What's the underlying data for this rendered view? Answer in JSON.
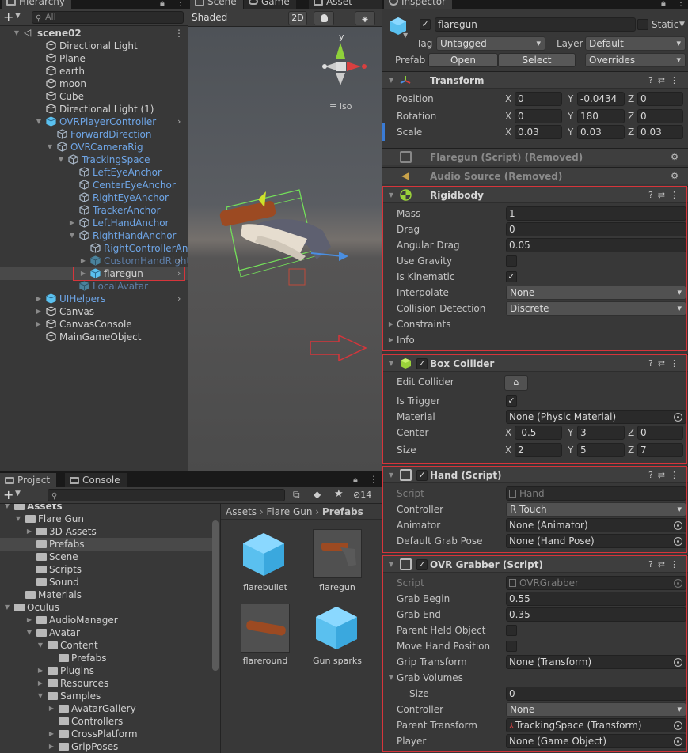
{
  "hierarchy": {
    "tab": "Hierarchy",
    "search_placeholder": "All",
    "items": [
      {
        "label": "scene02"
      },
      {
        "label": "Directional Light"
      },
      {
        "label": "Plane"
      },
      {
        "label": "earth"
      },
      {
        "label": "moon"
      },
      {
        "label": "Cube"
      },
      {
        "label": "Directional Light (1)"
      },
      {
        "label": "OVRPlayerController"
      },
      {
        "label": "ForwardDirection"
      },
      {
        "label": "OVRCameraRig"
      },
      {
        "label": "TrackingSpace"
      },
      {
        "label": "LeftEyeAnchor"
      },
      {
        "label": "CenterEyeAnchor"
      },
      {
        "label": "RightEyeAnchor"
      },
      {
        "label": "TrackerAnchor"
      },
      {
        "label": "LeftHandAnchor"
      },
      {
        "label": "RightHandAnchor"
      },
      {
        "label": "RightControllerAnchor"
      },
      {
        "label": "CustomHandRight"
      },
      {
        "label": "flaregun"
      },
      {
        "label": "LocalAvatar"
      },
      {
        "label": "UIHelpers"
      },
      {
        "label": "Canvas"
      },
      {
        "label": "CanvasConsole"
      },
      {
        "label": "MainGameObject"
      }
    ]
  },
  "scene": {
    "tabs": [
      "Scene",
      "Game",
      "Asset"
    ],
    "shading": "Shaded",
    "mode_2d": "2D",
    "gizmo_y": "y",
    "gizmo_projection": "Iso"
  },
  "inspector": {
    "tab": "Inspector",
    "object_name": "flaregun",
    "static_label": "Static",
    "tag_label": "Tag",
    "tag_value": "Untagged",
    "layer_label": "Layer",
    "layer_value": "Default",
    "prefab_label": "Prefab",
    "prefab_open": "Open",
    "prefab_select": "Select",
    "prefab_overrides": "Overrides",
    "transform": {
      "title": "Transform",
      "position_label": "Position",
      "position": [
        "0",
        "-0.0434",
        "0"
      ],
      "rotation_label": "Rotation",
      "rotation": [
        "0",
        "180",
        "0"
      ],
      "scale_label": "Scale",
      "scale": [
        "0.03",
        "0.03",
        "0.03"
      ],
      "axes": [
        "X",
        "Y",
        "Z"
      ]
    },
    "removed1": "Flaregun (Script) (Removed)",
    "removed2": "Audio Source (Removed)",
    "rigidbody": {
      "title": "Rigidbody",
      "mass_label": "Mass",
      "mass": "1",
      "drag_label": "Drag",
      "drag": "0",
      "angular_drag_label": "Angular Drag",
      "angular_drag": "0.05",
      "use_gravity_label": "Use Gravity",
      "is_kinematic_label": "Is Kinematic",
      "interpolate_label": "Interpolate",
      "interpolate": "None",
      "collision_label": "Collision Detection",
      "collision": "Discrete",
      "constraints_label": "Constraints",
      "info_label": "Info"
    },
    "box_collider": {
      "title": "Box Collider",
      "edit_label": "Edit Collider",
      "is_trigger_label": "Is Trigger",
      "material_label": "Material",
      "material": "None (Physic Material)",
      "center_label": "Center",
      "center": [
        "-0.5",
        "3",
        "0"
      ],
      "size_label": "Size",
      "size": [
        "2",
        "5",
        "7"
      ]
    },
    "hand_script": {
      "title": "Hand (Script)",
      "script_label": "Script",
      "script": "Hand",
      "controller_label": "Controller",
      "controller": "R Touch",
      "animator_label": "Animator",
      "animator": "None (Animator)",
      "grab_pose_label": "Default Grab Pose",
      "grab_pose": "None (Hand Pose)"
    },
    "ovr_grabber": {
      "title": "OVR Grabber (Script)",
      "script_label": "Script",
      "script": "OVRGrabber",
      "grab_begin_label": "Grab Begin",
      "grab_begin": "0.55",
      "grab_end_label": "Grab End",
      "grab_end": "0.35",
      "parent_held_label": "Parent Held Object",
      "move_hand_label": "Move Hand Position",
      "grip_label": "Grip Transform",
      "grip": "None (Transform)",
      "volumes_label": "Grab Volumes",
      "vol_size_label": "Size",
      "vol_size": "0",
      "controller_label": "Controller",
      "controller": "None",
      "parent_transform_label": "Parent Transform",
      "parent_transform": "TrackingSpace (Transform)",
      "player_label": "Player",
      "player": "None (Game Object)"
    }
  },
  "project": {
    "tabs": [
      "Project",
      "Console"
    ],
    "hidden_count": "14",
    "tree": [
      {
        "label": "Assets"
      },
      {
        "label": "Flare Gun"
      },
      {
        "label": "3D Assets"
      },
      {
        "label": "Prefabs"
      },
      {
        "label": "Scene"
      },
      {
        "label": "Scripts"
      },
      {
        "label": "Sound"
      },
      {
        "label": "Materials"
      },
      {
        "label": "Oculus"
      },
      {
        "label": "AudioManager"
      },
      {
        "label": "Avatar"
      },
      {
        "label": "Content"
      },
      {
        "label": "Prefabs"
      },
      {
        "label": "Plugins"
      },
      {
        "label": "Resources"
      },
      {
        "label": "Samples"
      },
      {
        "label": "AvatarGallery"
      },
      {
        "label": "Controllers"
      },
      {
        "label": "CrossPlatform"
      },
      {
        "label": "GripPoses"
      }
    ],
    "breadcrumb": [
      "Assets",
      "Flare Gun",
      "Prefabs"
    ],
    "assets": [
      {
        "label": "flarebullet"
      },
      {
        "label": "flaregun"
      },
      {
        "label": "flareround"
      },
      {
        "label": "Gun sparks"
      }
    ]
  }
}
